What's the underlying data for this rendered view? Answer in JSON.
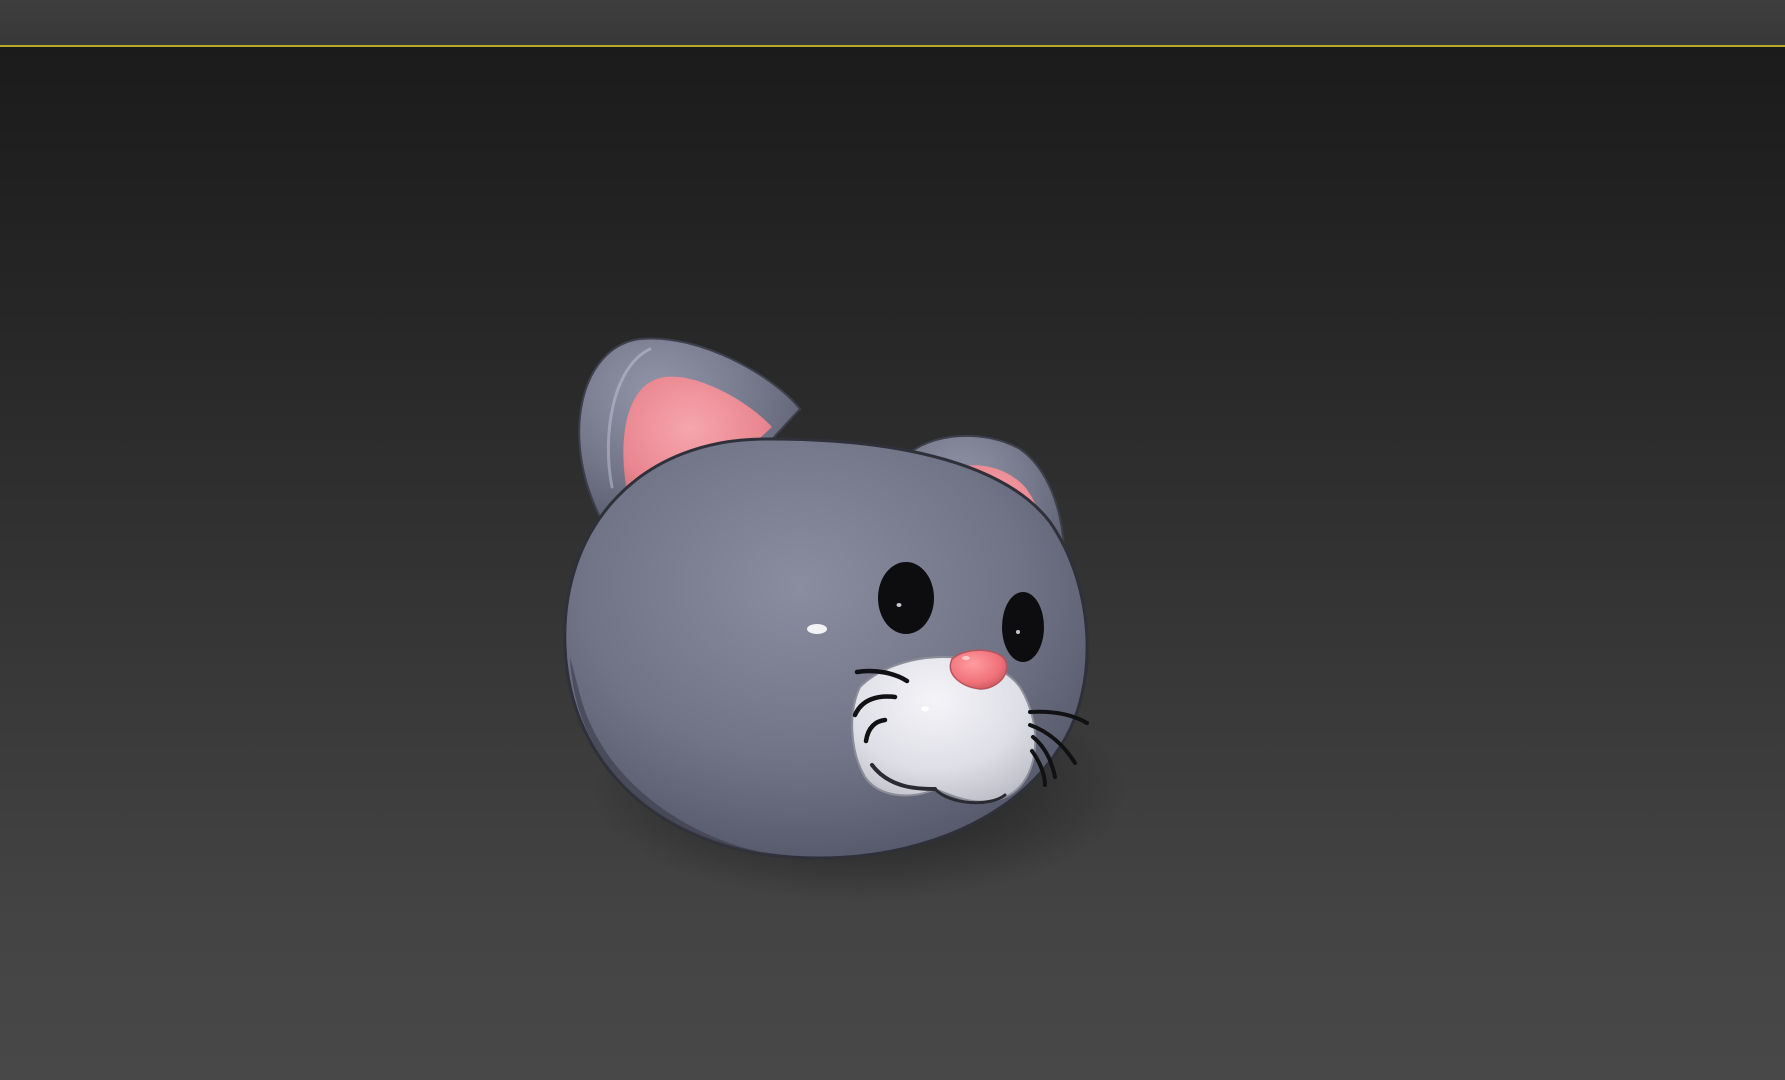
{
  "window": {
    "toolbar_label": "",
    "viewport_label": ""
  },
  "viewport": {
    "active_border_color": "#b8a826",
    "background_top_color": "#1b1b1b",
    "background_bottom_color": "#484848"
  },
  "scene": {
    "model": {
      "body_color": "#7a7d8e",
      "inner_ear_color": "#f08a92",
      "muzzle_color": "#e6e6ec",
      "nose_color": "#f47a7e",
      "eye_color": "#0d0d0f"
    }
  }
}
